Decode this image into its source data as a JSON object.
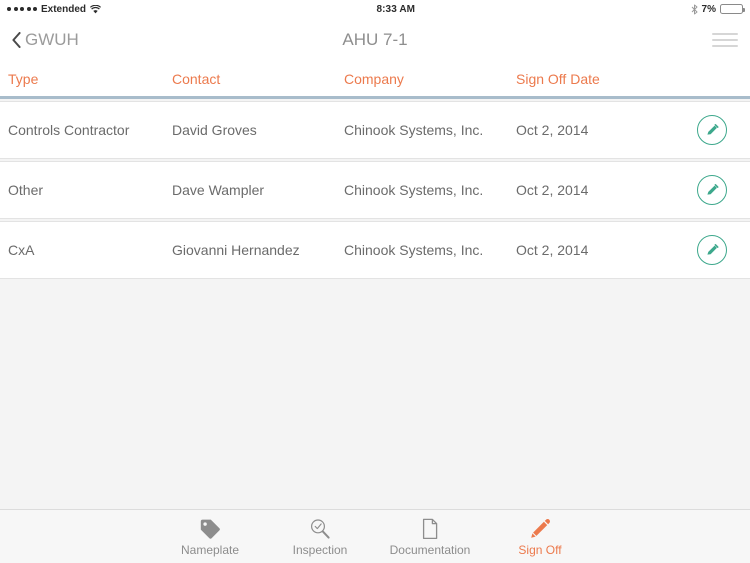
{
  "status_bar": {
    "signal_dots": 5,
    "carrier": "Extended",
    "wifi_icon": "wifi-icon",
    "time": "8:33 AM",
    "bluetooth_icon": "bluetooth-icon",
    "battery_percent": "7%",
    "battery_level": 7,
    "battery_color": "#e8433b"
  },
  "navbar": {
    "back_icon": "chevron-left-icon",
    "back_label": "GWUH",
    "title": "AHU 7-1",
    "menu_icon": "hamburger-menu-icon"
  },
  "table": {
    "header_color": "#ec7a4d",
    "columns": [
      {
        "key": "type",
        "label": "Type"
      },
      {
        "key": "contact",
        "label": "Contact"
      },
      {
        "key": "company",
        "label": "Company"
      },
      {
        "key": "date",
        "label": "Sign Off Date"
      }
    ],
    "rows": [
      {
        "type": "Controls Contractor",
        "contact": "David Groves",
        "company": "Chinook Systems, Inc.",
        "date": "Oct 2, 2014",
        "action_icon": "edit-pencil-icon"
      },
      {
        "type": "Other",
        "contact": "Dave Wampler",
        "company": "Chinook Systems, Inc.",
        "date": "Oct 2, 2014",
        "action_icon": "edit-pencil-icon"
      },
      {
        "type": "CxA",
        "contact": "Giovanni Hernandez",
        "company": "Chinook Systems, Inc.",
        "date": "Oct 2, 2014",
        "action_icon": "edit-pencil-icon"
      }
    ],
    "edit_button_color": "#3da88c",
    "separator_color": "#a8bccb"
  },
  "tabbar": {
    "active_color": "#ec7a4d",
    "inactive_color": "#8d8d8d",
    "tabs": [
      {
        "id": "nameplate",
        "label": "Nameplate",
        "icon": "tag-icon",
        "active": false
      },
      {
        "id": "inspection",
        "label": "Inspection",
        "icon": "magnifier-check-icon",
        "active": false
      },
      {
        "id": "documentation",
        "label": "Documentation",
        "icon": "document-page-icon",
        "active": false
      },
      {
        "id": "signoff",
        "label": "Sign Off",
        "icon": "pen-icon",
        "active": true
      }
    ]
  }
}
